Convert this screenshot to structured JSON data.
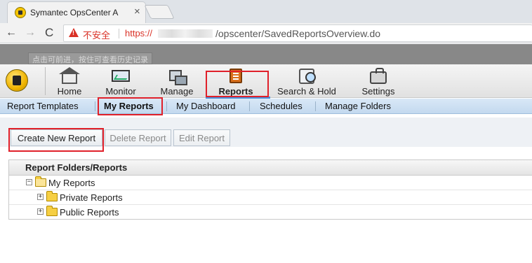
{
  "browser": {
    "tab_title": "Symantec OpsCenter A",
    "tab_close": "×",
    "back": "←",
    "forward": "→",
    "reload": "C",
    "insecure_label": "不安全",
    "url_scheme": "https://",
    "url_path": "/opscenter/SavedReportsOverview.do",
    "tooltip": "点击可前进，按住可查看历史记录"
  },
  "app": {
    "nav": [
      {
        "label": "Home",
        "icon": "home-icon"
      },
      {
        "label": "Monitor",
        "icon": "monitor-icon"
      },
      {
        "label": "Manage",
        "icon": "manage-icon"
      },
      {
        "label": "Reports",
        "icon": "reports-icon",
        "selected": true
      },
      {
        "label": "Search & Hold",
        "icon": "search-hold-icon"
      },
      {
        "label": "Settings",
        "icon": "settings-icon"
      }
    ],
    "subnav": [
      {
        "label": "Report Templates"
      },
      {
        "label": "My Reports",
        "selected": true
      },
      {
        "label": "My Dashboard"
      },
      {
        "label": "Schedules"
      },
      {
        "label": "Manage Folders"
      }
    ],
    "actions": {
      "create": "Create New Report",
      "delete": "Delete Report",
      "edit": "Edit Report"
    },
    "grid": {
      "header": "Report Folders/Reports",
      "rows": [
        {
          "label": "My Reports",
          "toggle": "−",
          "expanded": true
        },
        {
          "label": "Private Reports",
          "toggle": "+",
          "expanded": false
        },
        {
          "label": "Public Reports",
          "toggle": "+",
          "expanded": false
        }
      ]
    }
  },
  "colors": {
    "highlight": "#e0202a",
    "subnav_bg": "#c3d9ef",
    "insecure": "#d93025"
  }
}
